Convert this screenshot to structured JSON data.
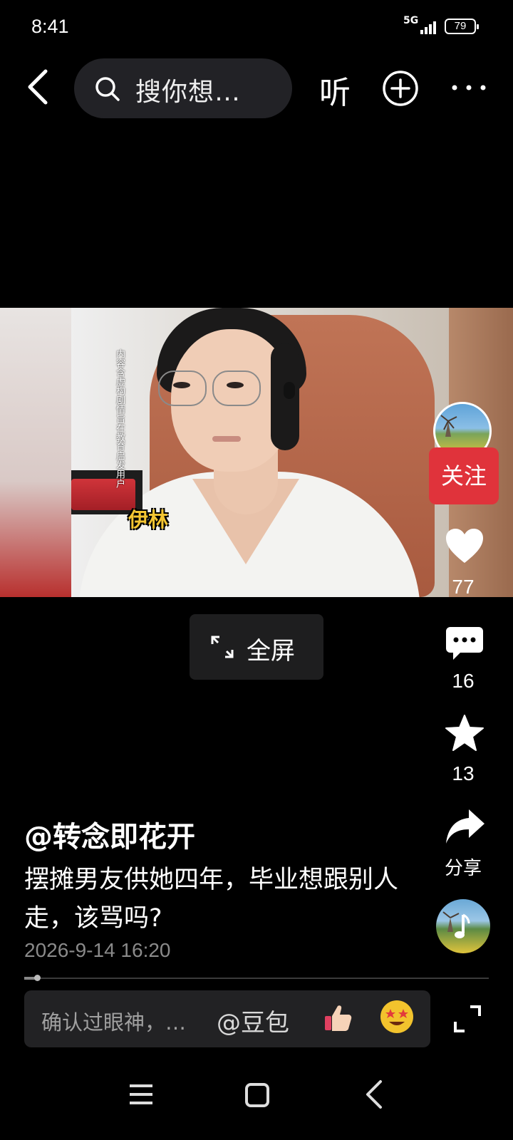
{
  "status_bar": {
    "time": "8:41",
    "network": "5G",
    "battery": "79"
  },
  "top_nav": {
    "search_placeholder": "搜你想…",
    "listen_label": "听"
  },
  "video": {
    "disclaimer": "内容含虚构剧情旨在教育启发用户",
    "name_tag": "伊林"
  },
  "fullscreen_label": "全屏",
  "side_rail": {
    "follow_label": "关注",
    "likes": "77",
    "comments": "16",
    "favorites": "13",
    "share_label": "分享"
  },
  "post": {
    "author": "@转念即花开",
    "title": "摆摊男友供她四年，毕业想跟别人走，该骂吗?",
    "date": "2026-9-14 16:20"
  },
  "comment_bar": {
    "placeholder": "确认过眼神，…",
    "mention": "@豆包"
  },
  "colors": {
    "background": "#000000",
    "follow_red": "#e0333b",
    "name_tag_yellow": "#f4c532",
    "date_gray": "#8a8a8a"
  }
}
